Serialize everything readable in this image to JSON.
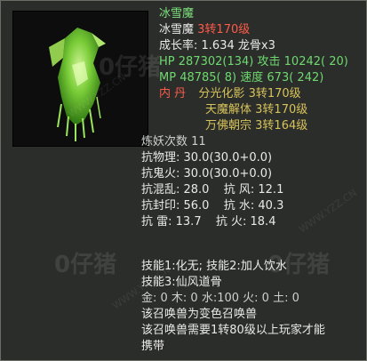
{
  "pet": {
    "title": "冰雪魔",
    "name": "冰雪魔",
    "level_text": "3转170级",
    "growth_label": "成长率",
    "growth_value": "1.634",
    "bone": "龙骨x3",
    "hp_label": "HP",
    "hp_value": "287302(134)",
    "attack_label": "攻击",
    "attack_value": "10242( 20)",
    "mp_label": "MP",
    "mp_value": "48785( 8)",
    "speed_label": "速度",
    "speed_value": "673( 242)",
    "neidan_label": "内  丹",
    "neidan": [
      {
        "name": "分光化影",
        "level": "3转170级"
      },
      {
        "name": "天魔解体",
        "level": "3转170级"
      },
      {
        "name": "万佛朝宗",
        "level": "3转164级"
      }
    ],
    "refine_label": "炼妖次数",
    "refine_value": "11",
    "resist": [
      "抗物理: 30.0(30.0+0.0)",
      "抗鬼火: 30.0(30.0+0.0)"
    ],
    "resist_pairs": [
      {
        "a": "抗混乱: 28.0",
        "b": "抗  风: 12.1"
      },
      {
        "a": "抗封印: 56.0",
        "b": "抗  水: 40.3"
      },
      {
        "a": "抗  雷: 13.7",
        "b": "抗  火: 18.4"
      }
    ],
    "skills_line1": "技能1:化无; 技能2:加人饮水",
    "skills_line2": "技能3:仙风道骨",
    "elements": "金: 0 木: 0 水:100 火: 0 土: 0",
    "note1": "该召唤兽为变色召唤兽",
    "note2": "该召唤兽需要1转80级以上玩家才能",
    "note3": "携带"
  },
  "watermark": {
    "logo": "0仔猪",
    "url": "WWW.YZZ.CN"
  },
  "colors": {
    "panel_bg": "#2b2d2a",
    "name_green": "#7ee07e",
    "level_red": "#ff5b4a",
    "stat_green": "#6fd96f",
    "neidan_gold": "#d6c25b"
  }
}
